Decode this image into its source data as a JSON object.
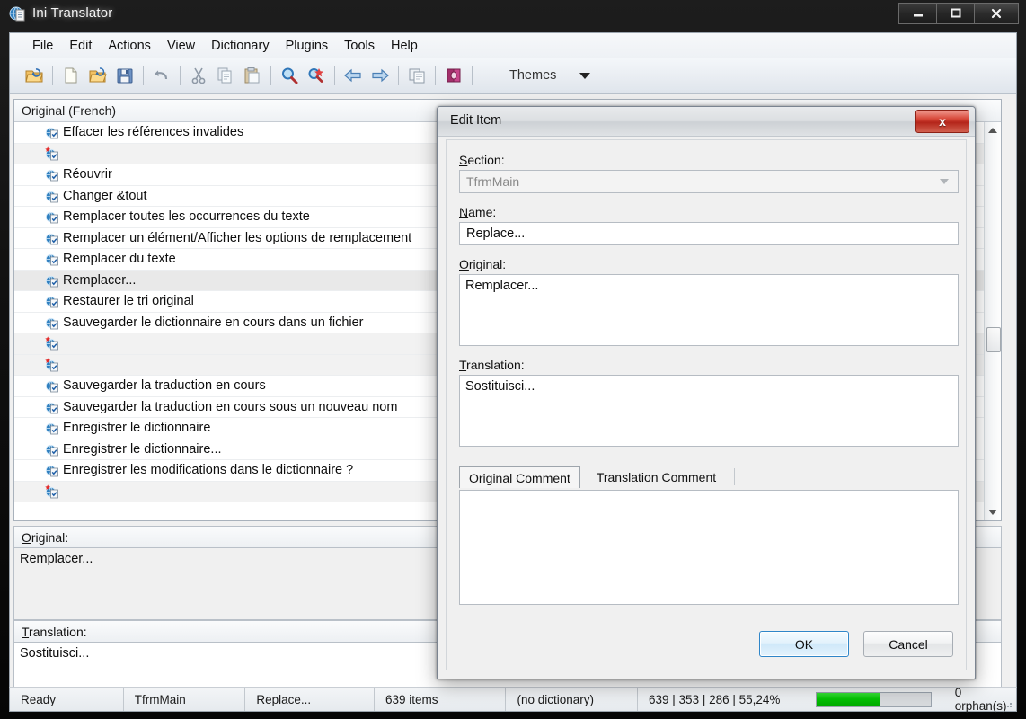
{
  "window": {
    "title": "Ini Translator",
    "icon": "app-globe-doc-icon",
    "minimize": "—",
    "maximize": "□",
    "close": "✕"
  },
  "menubar": {
    "items": [
      "File",
      "Edit",
      "Actions",
      "View",
      "Dictionary",
      "Plugins",
      "Tools",
      "Help"
    ]
  },
  "toolbar": {
    "buttons": [
      {
        "name": "open-project-icon",
        "tip": "Open project"
      },
      {
        "name": "new-file-icon",
        "tip": "New"
      },
      {
        "name": "open-file-icon",
        "tip": "Open"
      },
      {
        "name": "save-icon",
        "tip": "Save"
      },
      {
        "name": "undo-icon",
        "tip": "Undo"
      },
      {
        "name": "cut-icon",
        "tip": "Cut"
      },
      {
        "name": "copy-icon",
        "tip": "Copy"
      },
      {
        "name": "paste-icon",
        "tip": "Paste"
      },
      {
        "name": "search-icon",
        "tip": "Find"
      },
      {
        "name": "search-replace-icon",
        "tip": "Find and replace"
      },
      {
        "name": "back-arrow-icon",
        "tip": "Previous"
      },
      {
        "name": "forward-arrow-icon",
        "tip": "Next"
      },
      {
        "name": "duplicate-window-icon",
        "tip": "Duplicate"
      },
      {
        "name": "dictionary-book-icon",
        "tip": "Dictionary"
      }
    ],
    "themes_label": "Themes"
  },
  "list": {
    "header": "Original (French)",
    "rows": [
      {
        "text": "Effacer les références invalides",
        "flag": false,
        "alt": false,
        "selected": false
      },
      {
        "text": "",
        "flag": true,
        "alt": true,
        "selected": false
      },
      {
        "text": "Réouvrir",
        "flag": false,
        "alt": false,
        "selected": false
      },
      {
        "text": "Changer &tout",
        "flag": false,
        "alt": false,
        "selected": false
      },
      {
        "text": "Remplacer toutes les occurrences du texte",
        "flag": false,
        "alt": false,
        "selected": false
      },
      {
        "text": "Remplacer un élément/Afficher les options de remplacement",
        "flag": false,
        "alt": false,
        "selected": false
      },
      {
        "text": "Remplacer du texte",
        "flag": false,
        "alt": false,
        "selected": false
      },
      {
        "text": "Remplacer...",
        "flag": false,
        "alt": false,
        "selected": true
      },
      {
        "text": "Restaurer le tri original",
        "flag": false,
        "alt": false,
        "selected": false
      },
      {
        "text": "Sauvegarder le dictionnaire en cours dans un fichier",
        "flag": false,
        "alt": false,
        "selected": false
      },
      {
        "text": "",
        "flag": true,
        "alt": true,
        "selected": false
      },
      {
        "text": "",
        "flag": true,
        "alt": true,
        "selected": false
      },
      {
        "text": "Sauvegarder la traduction en cours",
        "flag": false,
        "alt": false,
        "selected": false
      },
      {
        "text": "Sauvegarder la traduction en cours sous un nouveau nom",
        "flag": false,
        "alt": false,
        "selected": false
      },
      {
        "text": "Enregistrer le dictionnaire",
        "flag": false,
        "alt": false,
        "selected": false
      },
      {
        "text": "Enregistrer le dictionnaire...",
        "flag": false,
        "alt": false,
        "selected": false
      },
      {
        "text": "Enregistrer les modifications dans le dictionnaire ?",
        "flag": false,
        "alt": false,
        "selected": false
      },
      {
        "text": "",
        "flag": true,
        "alt": true,
        "selected": false
      }
    ]
  },
  "panes": {
    "original_label": "Original:",
    "original_value": "Remplacer...",
    "translation_label": "Translation:",
    "translation_value": "Sostituisci..."
  },
  "statusbar": {
    "state": "Ready",
    "section": "TfrmMain",
    "name": "Replace...",
    "items": "639 items",
    "dictionary": "(no dictionary)",
    "counts": "639 | 353 | 286 | 55,24%",
    "progress_percent": 55.24,
    "progress_color": "#04c204",
    "orphans": "0 orphan(s)"
  },
  "dialog": {
    "title": "Edit Item",
    "close_label": "x",
    "section_label": "Section:",
    "section_label_accel": "S",
    "section_value": "TfrmMain",
    "name_label": "Name:",
    "name_label_accel": "N",
    "name_value": "Replace...",
    "original_label": "Original:",
    "original_label_accel": "O",
    "original_value": "Remplacer...",
    "translation_label": "Translation:",
    "translation_label_accel": "T",
    "translation_value": "Sostituisci...",
    "tabs": [
      {
        "label": "Original Comment",
        "active": true
      },
      {
        "label": "Translation Comment",
        "active": false
      }
    ],
    "comment_value": "",
    "ok_label": "OK",
    "cancel_label": "Cancel"
  }
}
